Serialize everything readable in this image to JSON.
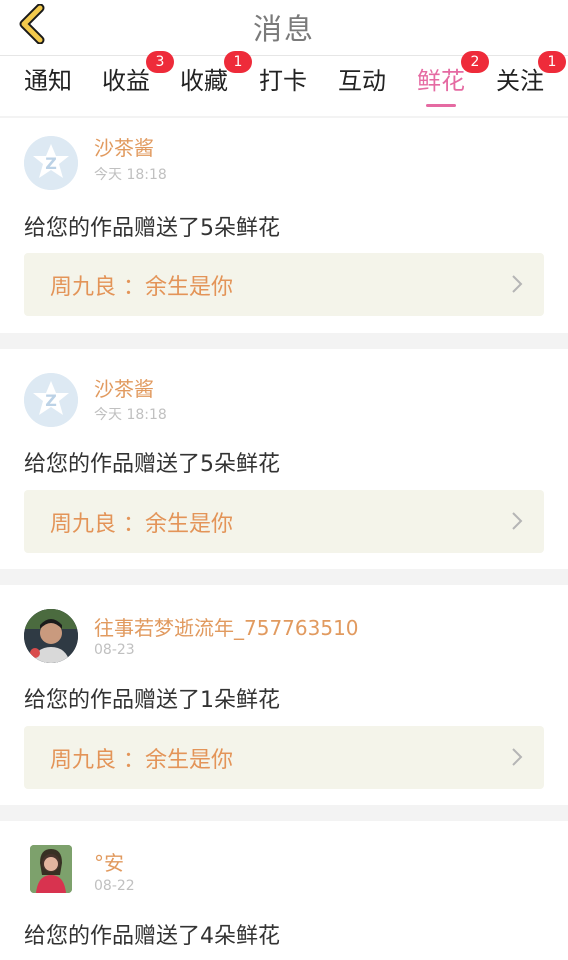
{
  "header": {
    "title": "消息",
    "back_icon": "chevron-left-icon",
    "back_color": "#f2c94c"
  },
  "tabs": [
    {
      "label": "通知",
      "badge": ""
    },
    {
      "label": "收益",
      "badge": "3"
    },
    {
      "label": "收藏",
      "badge": "1"
    },
    {
      "label": "打卡",
      "badge": ""
    },
    {
      "label": "互动",
      "badge": ""
    },
    {
      "label": "鲜花",
      "badge": "2",
      "active": true
    },
    {
      "label": "关注",
      "badge": "1"
    }
  ],
  "colors": {
    "accent": "#e56aa2",
    "badge": "#ee2b3a",
    "username": "#e19a5f",
    "work_text": "#e39458",
    "work_bg": "#f4f4ea"
  },
  "items": [
    {
      "username": "沙茶酱",
      "time": "今天 18:18",
      "message": "给您的作品赠送了5朵鲜花",
      "work": "周九良 ：余生是你",
      "avatar": "default-avatar-icon"
    },
    {
      "username": "沙茶酱",
      "time": "今天 18:18",
      "message": "给您的作品赠送了5朵鲜花",
      "work": "周九良 ：余生是你",
      "avatar": "default-avatar-icon"
    },
    {
      "username": "往事若梦逝流年_757763510",
      "time": "08-23",
      "message": "给您的作品赠送了1朵鲜花",
      "work": "周九良 ：余生是你",
      "avatar": "user-photo"
    },
    {
      "username": "°安",
      "time": "08-22",
      "message": "给您的作品赠送了4朵鲜花",
      "avatar": "user-photo"
    }
  ]
}
